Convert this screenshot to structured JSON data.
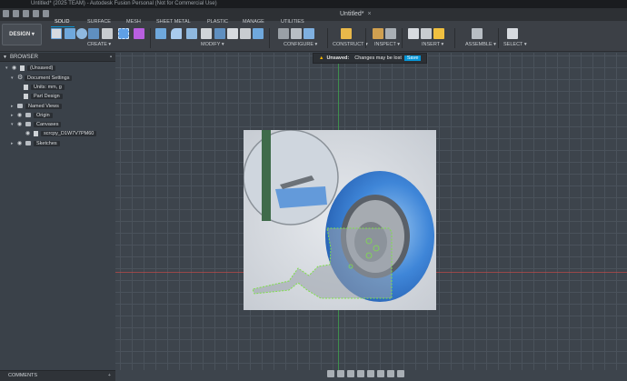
{
  "window_title": "Untitled* (2025 TEAM) - Autodesk Fusion Personal (Not for Commercial Use)",
  "document_tab": {
    "name": "Untitled*",
    "close": "×"
  },
  "workspace": {
    "label": "DESIGN ▾"
  },
  "tabs": [
    "SOLID",
    "SURFACE",
    "MESH",
    "SHEET METAL",
    "PLASTIC",
    "MANAGE",
    "UTILITIES"
  ],
  "active_tab": "SOLID",
  "groups": [
    "CREATE ▾",
    "MODIFY ▾",
    "CONFIGURE ▾",
    "CONSTRUCT ▾",
    "INSPECT ▾",
    "INSERT ▾",
    "ASSEMBLE ▾",
    "SELECT ▾"
  ],
  "browser": {
    "title": "BROWSER",
    "root": "(Unsaved)",
    "items": [
      {
        "label": "Document Settings"
      },
      {
        "label": "Units: mm, g"
      },
      {
        "label": "Part Design"
      },
      {
        "label": "Named Views"
      },
      {
        "label": "Origin"
      },
      {
        "label": "Canvases"
      },
      {
        "label": "scrcpy_D1W7V7PM60"
      },
      {
        "label": "Sketches"
      }
    ]
  },
  "notice": {
    "title": "Unsaved:",
    "message": "Changes may be lost",
    "action": "Save"
  },
  "comments": {
    "label": "COMMENTS",
    "add": "+"
  },
  "colors": {
    "accent": "#0696d7",
    "warning": "#f5b400",
    "x_axis": "#c04848",
    "y_axis": "#3fa34d",
    "sketch": "#7fe04a"
  }
}
